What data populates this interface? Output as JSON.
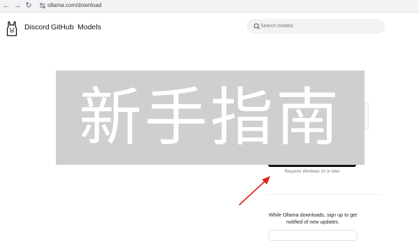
{
  "browser": {
    "url": "ollama.com/download"
  },
  "header": {
    "nav": [
      {
        "label": "Discord"
      },
      {
        "label": "GitHub"
      },
      {
        "label": "Models"
      }
    ],
    "search": {
      "placeholder": "Search models"
    }
  },
  "overlay": {
    "text": "新手指南"
  },
  "download": {
    "requirement": "Requires Windows 10 or later"
  },
  "notify": {
    "text": "While Ollama downloads, sign up to get notified of new updates."
  },
  "colors": {
    "arrow": "#e0231b",
    "banner": "#cfcfcf"
  }
}
